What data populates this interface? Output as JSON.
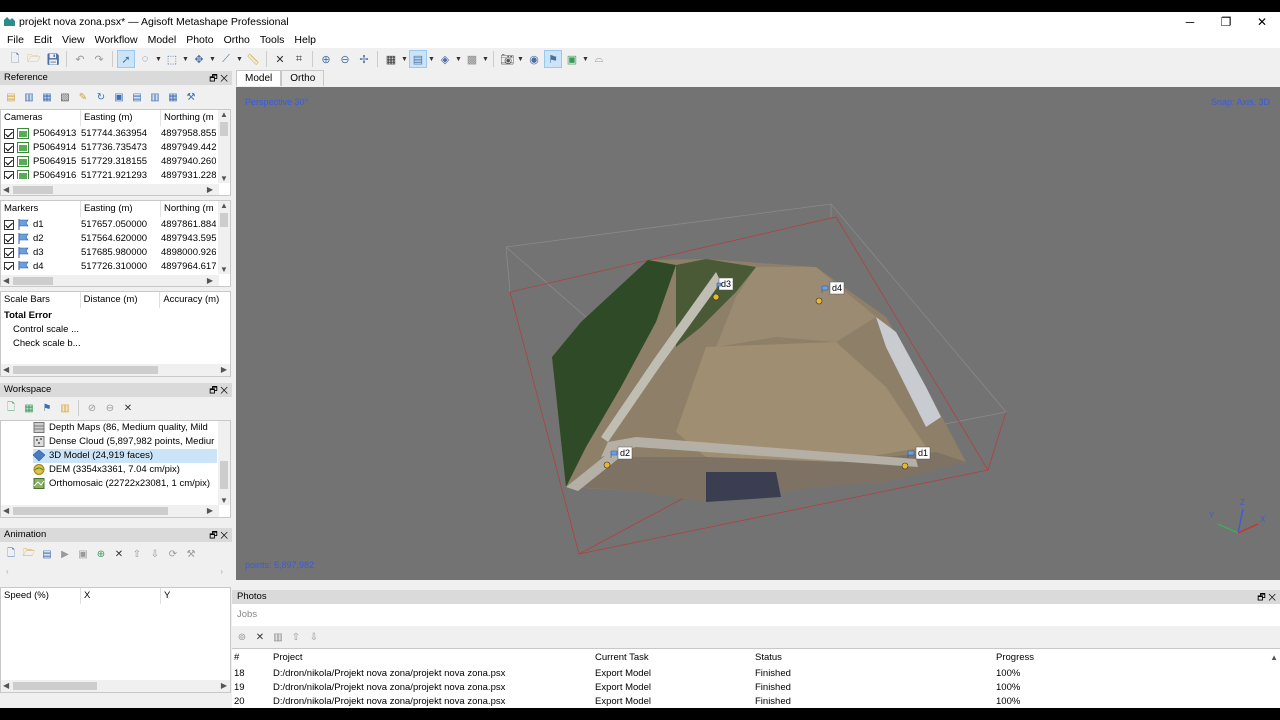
{
  "window": {
    "title": "projekt nova zona.psx* — Agisoft Metashape Professional",
    "minimize": "─",
    "restore": "❐",
    "close": "✕"
  },
  "menu": [
    "File",
    "Edit",
    "View",
    "Workflow",
    "Model",
    "Photo",
    "Ortho",
    "Tools",
    "Help"
  ],
  "reference": {
    "title": "Reference",
    "cameras": {
      "headers": [
        "Cameras",
        "Easting (m)",
        "Northing (m"
      ],
      "rows": [
        {
          "name": "P5064913",
          "easting": "517744.363954",
          "northing": "4897958.855"
        },
        {
          "name": "P5064914",
          "easting": "517736.735473",
          "northing": "4897949.442"
        },
        {
          "name": "P5064915",
          "easting": "517729.318155",
          "northing": "4897940.260"
        },
        {
          "name": "P5064916",
          "easting": "517721.921293",
          "northing": "4897931.228"
        }
      ]
    },
    "markers": {
      "headers": [
        "Markers",
        "Easting (m)",
        "Northing (m"
      ],
      "rows": [
        {
          "name": "d1",
          "easting": "517657.050000",
          "northing": "4897861.884"
        },
        {
          "name": "d2",
          "easting": "517564.620000",
          "northing": "4897943.595"
        },
        {
          "name": "d3",
          "easting": "517685.980000",
          "northing": "4898000.926"
        },
        {
          "name": "d4",
          "easting": "517726.310000",
          "northing": "4897964.617"
        }
      ]
    },
    "scalebars": {
      "headers": [
        "Scale Bars",
        "Distance (m)",
        "Accuracy (m)"
      ],
      "total_error": "Total Error",
      "control": "Control scale ...",
      "check": "Check scale b..."
    }
  },
  "workspace": {
    "title": "Workspace",
    "items": [
      {
        "label": "Depth Maps (86, Medium quality, Mild"
      },
      {
        "label": "Dense Cloud (5,897,982 points, Mediur"
      },
      {
        "label": "3D Model (24,919 faces)"
      },
      {
        "label": "DEM (3354x3361, 7.04 cm/pix)"
      },
      {
        "label": "Orthomosaic (22722x23081, 1 cm/pix)"
      }
    ]
  },
  "animation": {
    "title": "Animation",
    "headers": [
      "Speed (%)",
      "X",
      "Y"
    ]
  },
  "tabs": [
    "Model",
    "Ortho"
  ],
  "viewport": {
    "perspective": "Perspective 30°",
    "snap": "Snap: Axis, 3D",
    "points": "points: 5,897,982",
    "markers": [
      "d3",
      "d4",
      "d2",
      "d1"
    ],
    "axes": [
      "Z",
      "Y",
      "X"
    ]
  },
  "photos": {
    "title": "Photos",
    "jobs_tab": "Jobs",
    "headers": [
      "#",
      "Project",
      "Current Task",
      "Status",
      "Progress"
    ],
    "rows": [
      {
        "num": "18",
        "project": "D:/dron/nikola/Projekt nova zona/projekt nova zona.psx",
        "task": "Export Model",
        "status": "Finished",
        "progress": "100%"
      },
      {
        "num": "19",
        "project": "D:/dron/nikola/Projekt nova zona/projekt nova zona.psx",
        "task": "Export Model",
        "status": "Finished",
        "progress": "100%"
      },
      {
        "num": "20",
        "project": "D:/dron/nikola/Projekt nova zona/projekt nova zona.psx",
        "task": "Export Model",
        "status": "Finished",
        "progress": "100%"
      }
    ]
  },
  "panel_controls": {
    "float": "🗗",
    "close": "✕"
  }
}
